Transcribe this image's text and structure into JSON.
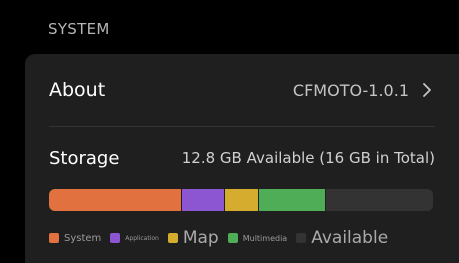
{
  "section": {
    "title": "SYSTEM"
  },
  "about": {
    "label": "About",
    "value": "CFMOTO-1.0.1",
    "chevron_icon": "chevron-right-icon"
  },
  "storage": {
    "label": "Storage",
    "summary": "12.8 GB Available (16 GB in Total)",
    "segments": [
      {
        "name": "System",
        "fraction": 0.345,
        "color": "#e1713f"
      },
      {
        "name": "Application",
        "fraction": 0.11,
        "color": "#8c55d2"
      },
      {
        "name": "Map",
        "fraction": 0.09,
        "color": "#d6ac2e"
      },
      {
        "name": "Multimedia",
        "fraction": 0.175,
        "color": "#4fac57"
      },
      {
        "name": "Available",
        "fraction": 0.28,
        "color": "#333333"
      }
    ],
    "legend": [
      {
        "label": "System",
        "color": "#e1713f"
      },
      {
        "label": "Application",
        "color": "#8c55d2"
      },
      {
        "label": "Map",
        "color": "#d6ac2e"
      },
      {
        "label": "Multimedia",
        "color": "#4fac57"
      },
      {
        "label": "Available",
        "color": "#333333"
      }
    ]
  }
}
